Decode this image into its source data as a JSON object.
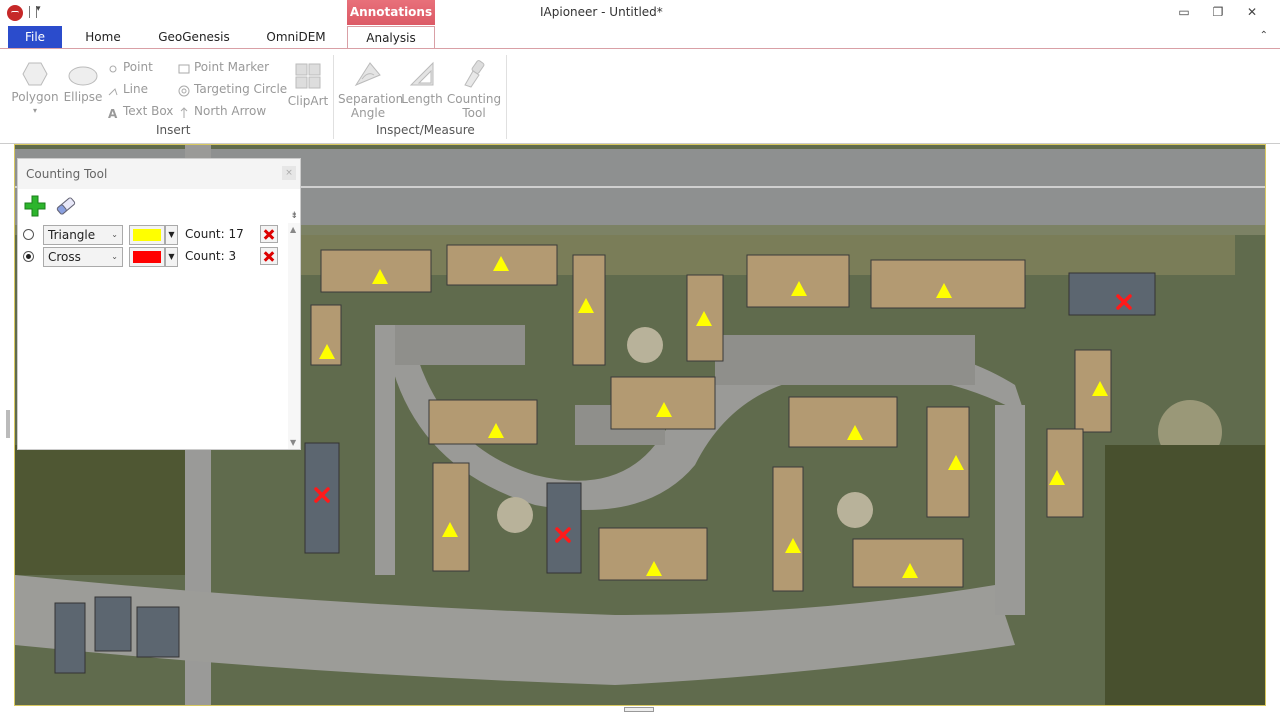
{
  "window": {
    "title": "IApioneer - Untitled*",
    "minimize_glyph": "▭",
    "maximize_glyph": "❐",
    "close_glyph": "✕",
    "qat_dropdown_glyph": "▾"
  },
  "ribbon": {
    "contextual_group": "Annotations",
    "tabs": [
      "File",
      "Home",
      "GeoGenesis",
      "OmniDEM",
      "Analysis"
    ],
    "active_tab": "Analysis",
    "collapse_glyph": "⌃",
    "groups": {
      "insert": {
        "label": "Insert",
        "polygon": "Polygon",
        "ellipse": "Ellipse",
        "point": "Point",
        "line": "Line",
        "text_box": "Text Box",
        "point_marker": "Point Marker",
        "targeting_circle": "Targeting Circle",
        "north_arrow": "North Arrow",
        "clipart": "ClipArt"
      },
      "inspect": {
        "label": "Inspect/Measure",
        "separation_angle": [
          "Separation",
          "Angle"
        ],
        "length": "Length",
        "counting_tool": [
          "Counting",
          "Tool"
        ]
      }
    },
    "icons": {
      "polygon": "polygon-icon",
      "ellipse": "ellipse-icon",
      "point": "point-icon",
      "line": "line-icon",
      "text_box": "text-box-icon",
      "point_marker": "point-marker-icon",
      "targeting_circle": "targeting-circle-icon",
      "north_arrow": "north-arrow-icon",
      "clipart": "clipart-icon",
      "separation_angle": "protractor-icon",
      "length": "ruler-triangle-icon",
      "counting_tool": "counting-tool-icon"
    }
  },
  "counting_tool": {
    "title": "Counting Tool",
    "close_glyph": "×",
    "items": [
      {
        "shape": "Triangle",
        "color": "#ffff00",
        "count_label": "Count: 17",
        "selected": false
      },
      {
        "shape": "Cross",
        "color": "#ff0000",
        "count_label": "Count: 3",
        "selected": true
      }
    ],
    "dropdown_glyph": "⌄",
    "color_dropdown_glyph": "▼",
    "scroll_up_glyph": "▲",
    "scroll_down_glyph": "▼",
    "menu_glyph": "⇟"
  },
  "map": {
    "markers": {
      "triangle_color": "#ffff00",
      "cross_color": "#ff0000",
      "triangle_count": 17,
      "cross_count": 3
    }
  }
}
